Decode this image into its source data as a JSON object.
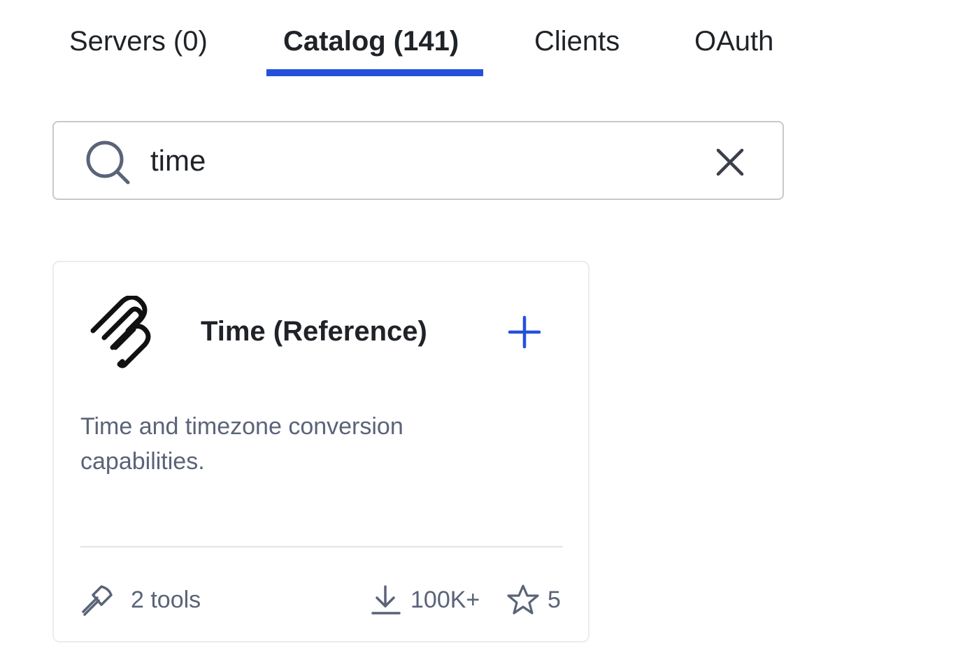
{
  "tabs": [
    {
      "label": "Servers (0)",
      "active": false
    },
    {
      "label": "Catalog (141)",
      "active": true
    },
    {
      "label": "Clients",
      "active": false
    },
    {
      "label": "OAuth",
      "active": false
    }
  ],
  "search": {
    "value": "time",
    "icon": "search-icon",
    "clear_icon": "close-icon"
  },
  "card": {
    "logo_icon": "mcp-logo-icon",
    "title": "Time (Reference)",
    "add_icon": "plus-icon",
    "description": "Time and timezone conversion capabilities.",
    "tools": "2 tools",
    "downloads": "100K+",
    "stars": "5"
  },
  "colors": {
    "accent": "#2451db",
    "muted_text": "#5a6378",
    "border": "#c8c8c8"
  }
}
